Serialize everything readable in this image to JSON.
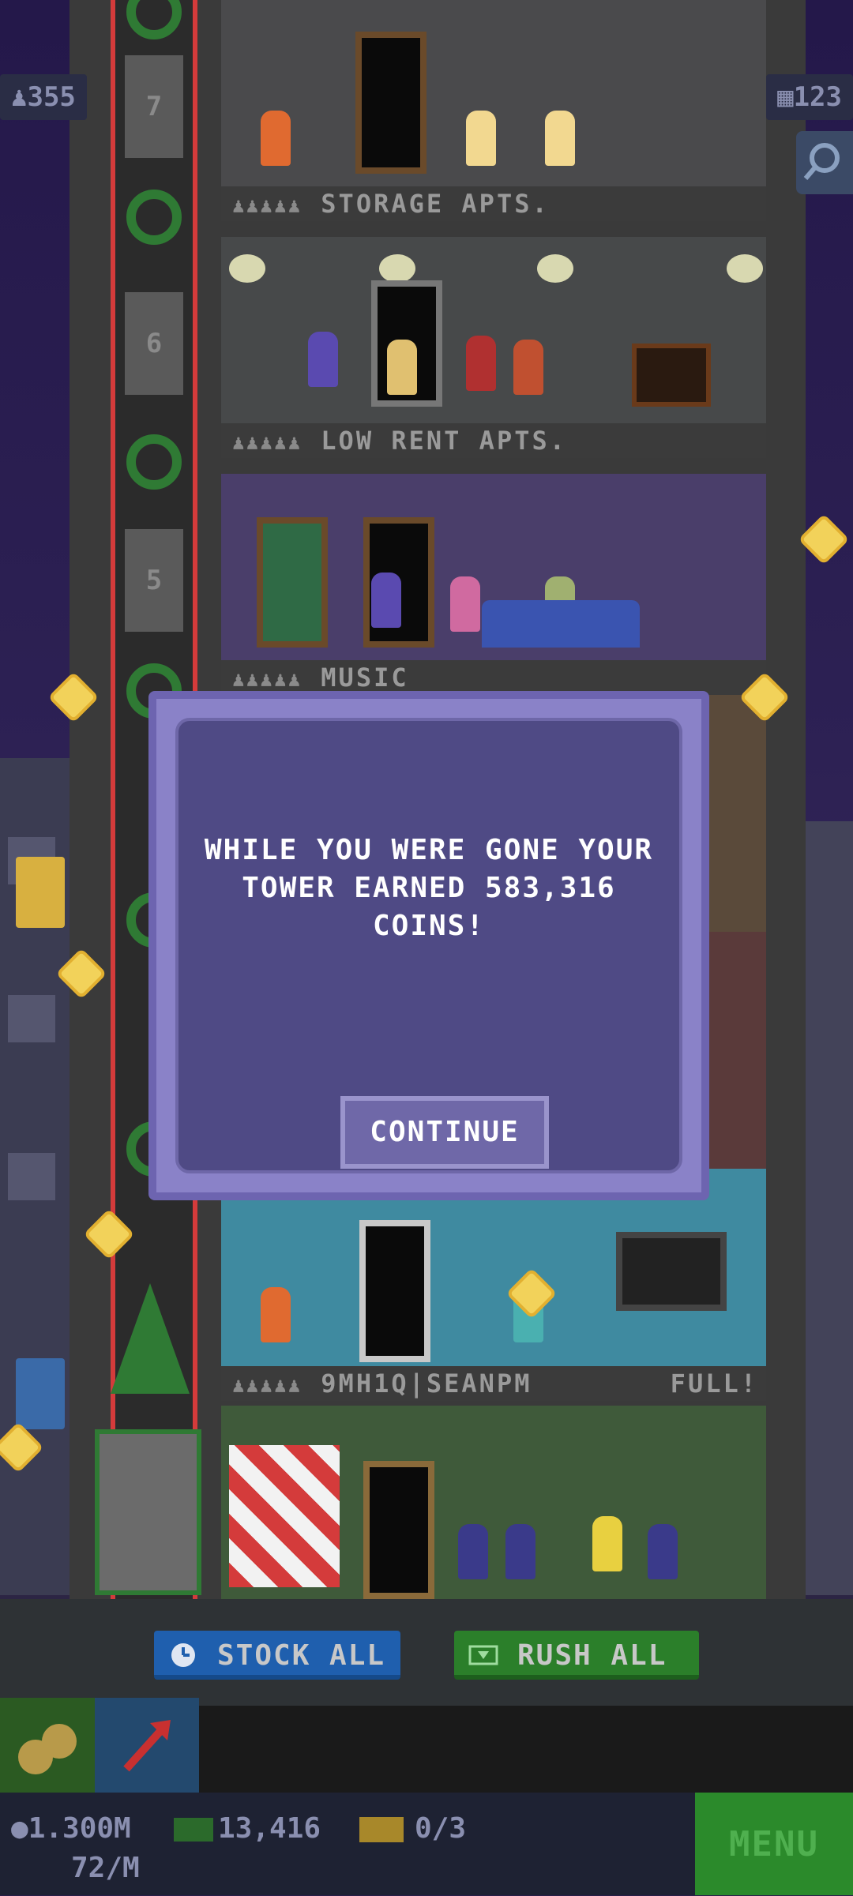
{
  "hud": {
    "population": "355",
    "floor_count": "123"
  },
  "floors": [
    {
      "label": "STORAGE APTS.",
      "full": ""
    },
    {
      "label": "LOW RENT APTS.",
      "full": ""
    },
    {
      "label": "MUSIC",
      "full": ""
    },
    {
      "label": "9MH1Q|SEANPM",
      "full": "FULL!"
    }
  ],
  "shaft_numbers": [
    "7",
    "6",
    "5"
  ],
  "dialog": {
    "message": "WHILE YOU WERE GONE YOUR TOWER EARNED 583,316 COINS!",
    "button": "CONTINUE"
  },
  "actions": {
    "stock_all": "STOCK ALL",
    "rush_all": "RUSH ALL"
  },
  "status": {
    "coins": "1.300M",
    "rate": "72/M",
    "bux": "13,416",
    "vip": "0/3",
    "menu": "MENU"
  },
  "colors": {
    "dialog_bg": "#4f4a85",
    "stock_button": "#1f5fae",
    "rush_button": "#2b7f2a",
    "menu_button": "#2b8a2b"
  }
}
